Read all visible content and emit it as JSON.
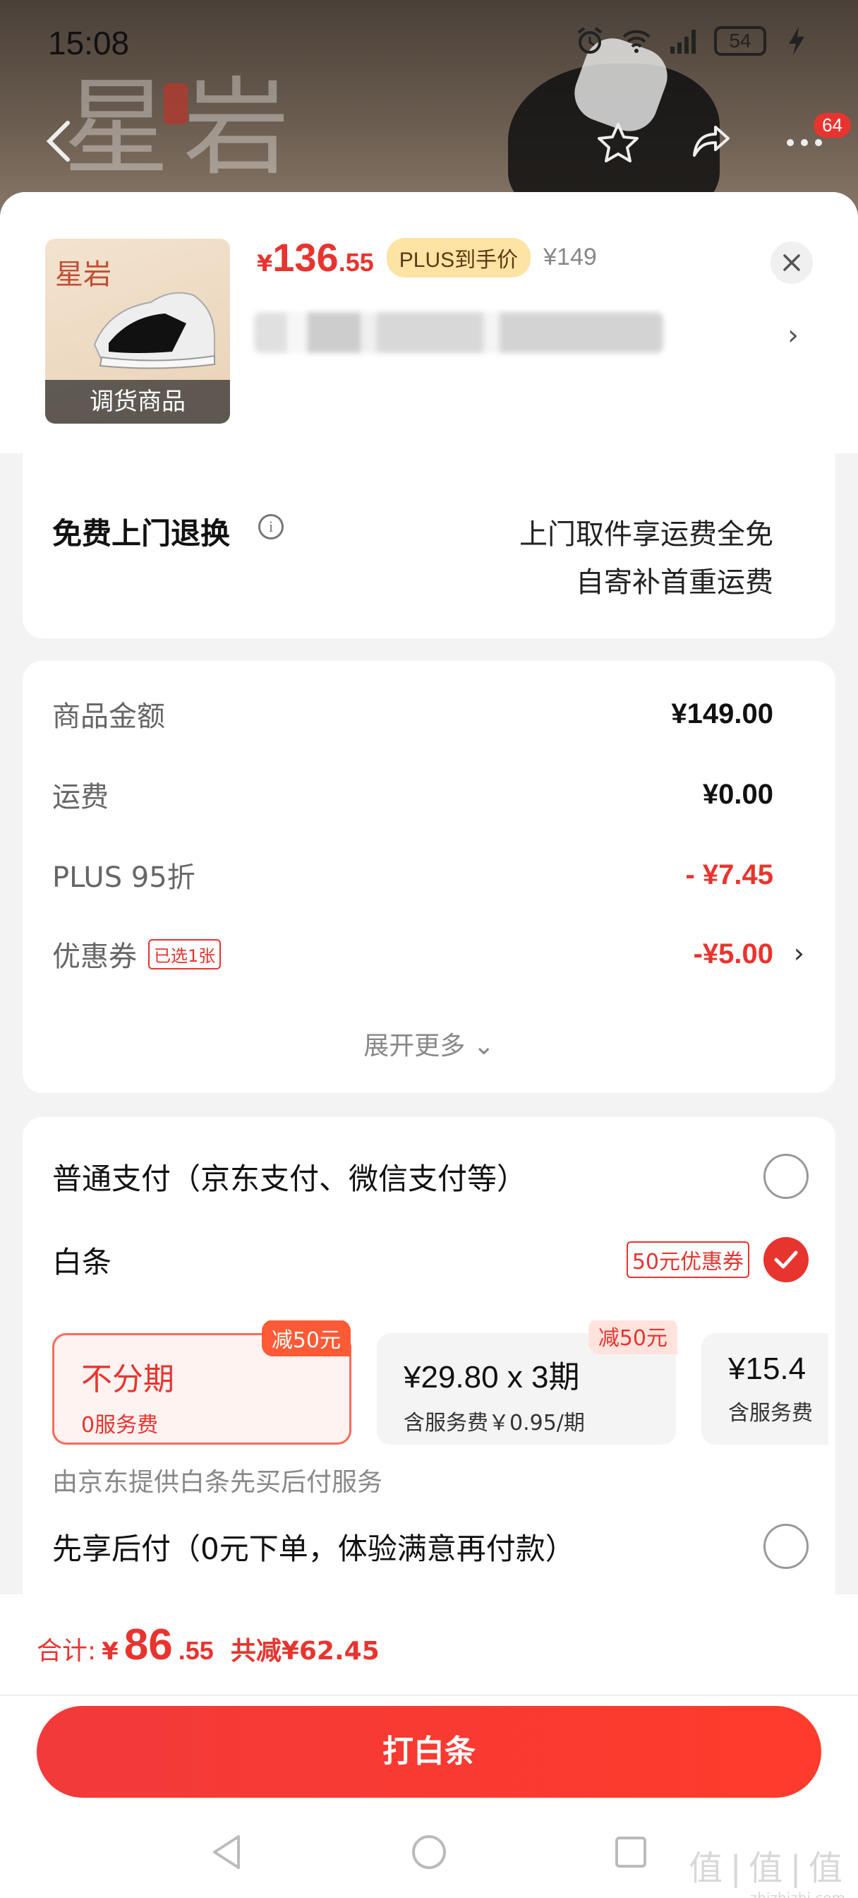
{
  "status_bar": {
    "time": "15:08",
    "battery": "54"
  },
  "nav": {
    "cart_badge": "64"
  },
  "product": {
    "thumb_label": "调货商品",
    "thumb_brand": "星岩",
    "price_currency": "¥",
    "price_int": "136",
    "price_dec": ".55",
    "plus_tag": "PLUS到手价",
    "original_price": "¥149"
  },
  "returns": {
    "title": "免费上门退换",
    "line1": "上门取件享运费全免",
    "line2": "自寄补首重运费"
  },
  "cost": {
    "rows": [
      {
        "label": "商品金额",
        "value": "¥149.00"
      },
      {
        "label": "运费",
        "value": "¥0.00"
      },
      {
        "label": "PLUS 95折",
        "value": "- ¥7.45"
      },
      {
        "label": "优惠券",
        "tag": "已选1张",
        "value": "-¥5.00"
      }
    ],
    "expand": "展开更多 ⌄"
  },
  "payment": {
    "normal": "普通支付（京东支付、微信支付等）",
    "baitiao": "白条",
    "baitiao_tag": "50元优惠券",
    "plans": [
      {
        "tag": "减50元",
        "main": "不分期",
        "sub": "0服务费"
      },
      {
        "tag": "减50元",
        "main": "¥29.80 x 3期",
        "sub": "含服务费￥0.95/期"
      },
      {
        "main": "¥15.4",
        "sub": "含服务费"
      }
    ],
    "note": "由京东提供白条先买后付服务",
    "later": "先享后付（0元下单，体验满意再付款）"
  },
  "summary": {
    "label": "合计:",
    "currency": "¥",
    "int": "86",
    "dec": ".55",
    "saved": "共减¥62.45",
    "button": "打白条"
  },
  "watermark": {
    "main": "值|值|值",
    "sub": "zhizhizhi.com"
  },
  "colors": {
    "accent": "#e8342f",
    "plus_tag_bg": "#fde3a4"
  }
}
